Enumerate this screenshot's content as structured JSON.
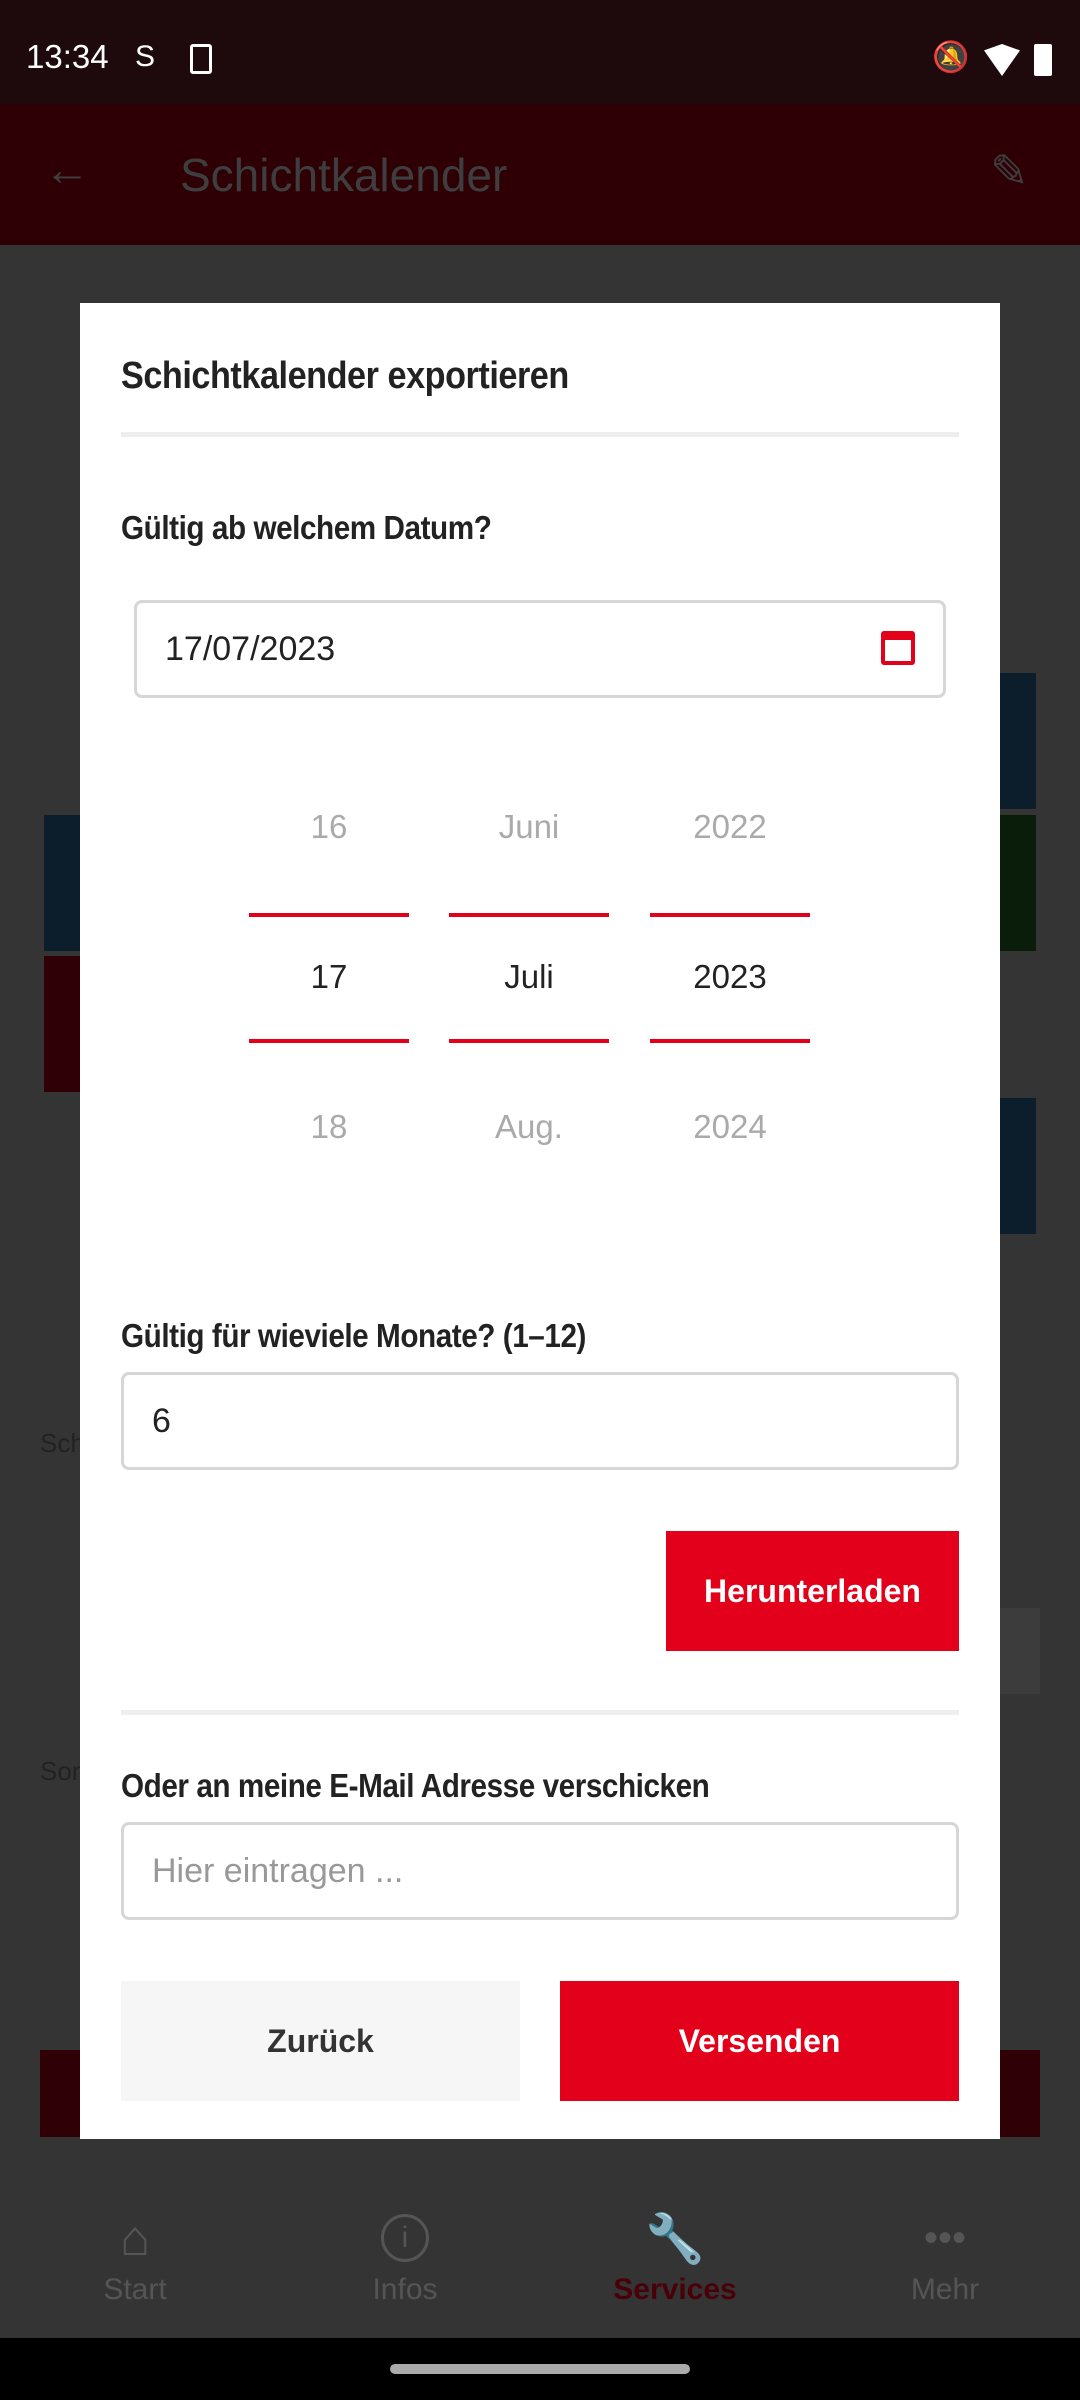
{
  "status": {
    "time": "13:34"
  },
  "appbar": {
    "title": "Schichtkalender"
  },
  "background": {
    "text1": "Sch",
    "text2": "Son"
  },
  "dialog": {
    "title": "Schichtkalender exportieren",
    "date_label": "Gültig ab welchem Datum?",
    "date_value": "17/07/2023",
    "picker": {
      "days": [
        "16",
        "17",
        "18"
      ],
      "months": [
        "Juni",
        "Juli",
        "Aug."
      ],
      "years": [
        "2022",
        "2023",
        "2024"
      ]
    },
    "months_label": "Gültig für wieviele Monate? (1–12)",
    "months_value": "6",
    "download": "Herunterladen",
    "email_label": "Oder an meine E-Mail Adresse verschicken",
    "email_placeholder": "Hier eintragen ...",
    "back": "Zurück",
    "send": "Versenden"
  },
  "nav": [
    {
      "label": "Start",
      "icon": "home-icon"
    },
    {
      "label": "Infos",
      "icon": "info-icon"
    },
    {
      "label": "Services",
      "icon": "wrench-icon",
      "active": true
    },
    {
      "label": "Mehr",
      "icon": "more-icon"
    }
  ],
  "colors": {
    "accent": "#e2001a"
  }
}
